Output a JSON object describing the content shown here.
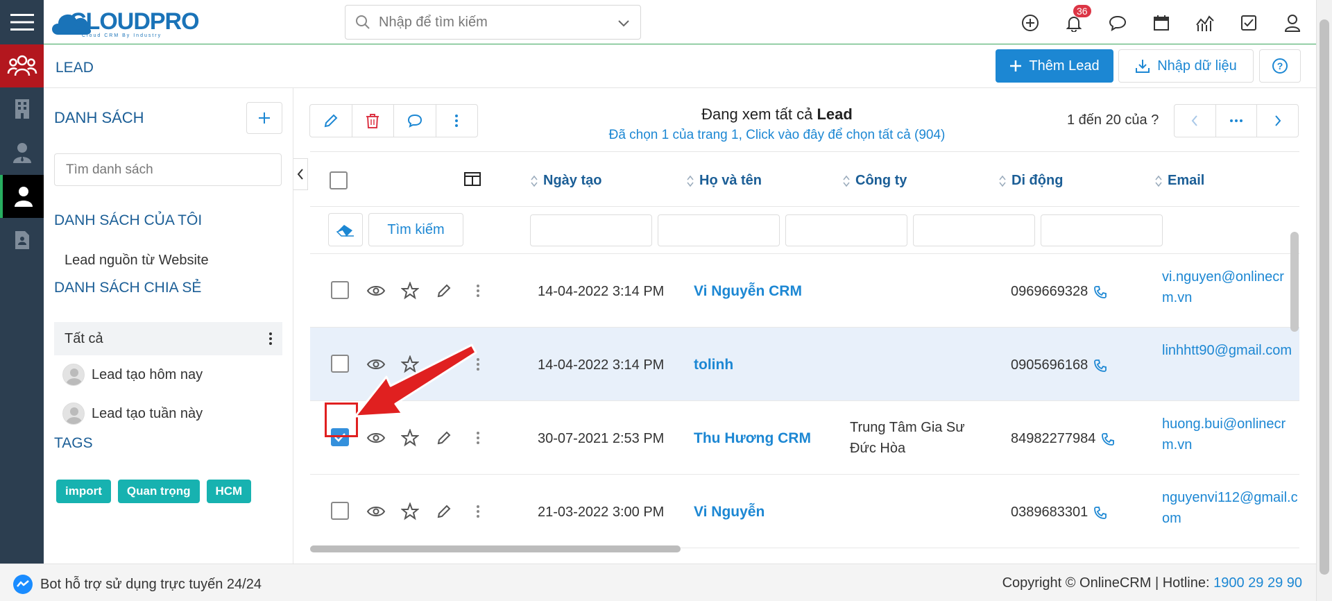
{
  "app": {
    "brand_main": "CLOUDPRO",
    "brand_tagline": "Cloud CRM By Industry"
  },
  "topbar": {
    "search_placeholder": "Nhập để tìm kiếm",
    "notification_count": "36"
  },
  "header": {
    "title": "LEAD",
    "add_button": "Thêm Lead",
    "import_button": "Nhập dữ liệu"
  },
  "left_panel": {
    "title": "DANH SÁCH",
    "search_placeholder": "Tìm danh sách",
    "my_lists_heading": "DANH SÁCH CỦA TÔI",
    "my_lists": [
      "Lead nguồn từ Website"
    ],
    "shared_heading": "DANH SÁCH CHIA SẺ",
    "shared_all": "Tất cả",
    "shared_lists": [
      "Lead tạo hôm nay",
      "Lead tạo tuần này"
    ],
    "tags_heading": "TAGS",
    "tags": [
      "import",
      "Quan trọng",
      "HCM"
    ]
  },
  "view": {
    "prefix": "Đang xem tất cả ",
    "module": "Lead",
    "selection_text": "Đã chọn 1 của trang 1, Click vào đây để chọn tất cả (904)",
    "pager_text": "1 đến 20 của ",
    "pager_unknown": "?"
  },
  "table": {
    "columns": [
      "Ngày tạo",
      "Họ và tên",
      "Công ty",
      "Di động",
      "Email"
    ],
    "search_button": "Tìm kiếm",
    "rows": [
      {
        "date": "14-04-2022 3:14 PM",
        "name": "Vi Nguyễn CRM",
        "company": "",
        "phone": "0969669328",
        "email": "vi.nguyen@onlinecrm.vn",
        "checked": false
      },
      {
        "date": "14-04-2022 3:14 PM",
        "name": "tolinh",
        "company": "",
        "phone": "0905696168",
        "email": "linhhtt90@gmail.com",
        "checked": false
      },
      {
        "date": "30-07-2021 2:53 PM",
        "name": "Thu Hương CRM",
        "company": "Trung Tâm Gia Sư Đức Hòa",
        "phone": "84982277984",
        "email": "huong.bui@onlinecrm.vn",
        "checked": true
      },
      {
        "date": "21-03-2022 3:00 PM",
        "name": "Vi Nguyễn",
        "company": "",
        "phone": "0389683301",
        "email": "nguyenvi112@gmail.com",
        "checked": false
      }
    ]
  },
  "footer": {
    "chatbot": "Bot hỗ trợ sử dụng trực tuyến 24/24",
    "copyright": "Copyright © OnlineCRM | Hotline: ",
    "hotline": "1900 29 29 90"
  },
  "colors": {
    "primary": "#1c87d3",
    "heading": "#1b5e96",
    "sidebar": "#2c3e50",
    "active_module": "#b3171e",
    "tag": "#17b2b0",
    "callout": "#e02020"
  }
}
